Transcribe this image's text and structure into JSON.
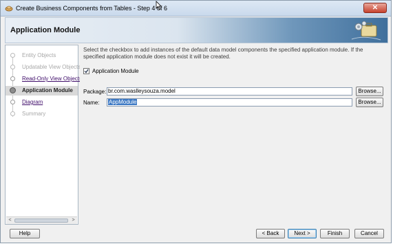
{
  "window": {
    "title": "Create Business Components from Tables - Step 4 of 6",
    "close_label": "✕"
  },
  "header": {
    "title": "Application Module"
  },
  "nav": {
    "items": [
      {
        "label": "Entity Objects",
        "state": "disabled"
      },
      {
        "label": "Updatable View Objects",
        "state": "disabled"
      },
      {
        "label": "Read-Only View Objects",
        "state": "link"
      },
      {
        "label": "Application Module",
        "state": "active"
      },
      {
        "label": "Diagram",
        "state": "link"
      },
      {
        "label": "Summary",
        "state": "future"
      }
    ],
    "scroll_left": "<",
    "scroll_right": ">"
  },
  "content": {
    "description": "Select the checkbox to add instances of the default data model components the specified application module.  If the specified application module does not exist it will be created.",
    "checkbox_label": "Application Module",
    "checkbox_checked": true,
    "package_label": "Package:",
    "package_value": "br.com.waslleysouza.model",
    "name_label": "Name:",
    "name_value": "AppModule",
    "browse_label": "Browse..."
  },
  "buttons": {
    "help": "Help",
    "back": "< Back",
    "next": "Next >",
    "finish": "Finish",
    "cancel": "Cancel"
  },
  "colors": {
    "link": "#400e6b",
    "selection": "#3d79c4",
    "close": "#c7422e"
  }
}
